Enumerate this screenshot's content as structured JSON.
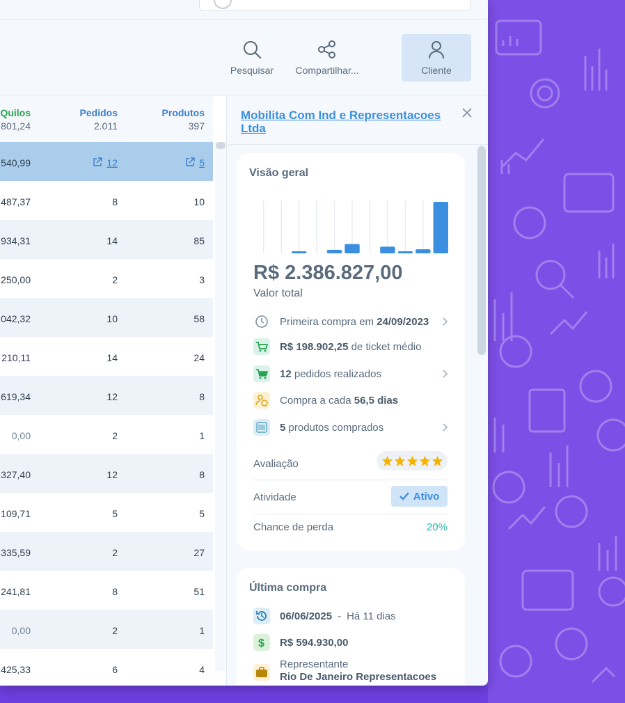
{
  "toolbar": {
    "search_label": "Pesquisar",
    "share_label": "Compartilhar...",
    "client_label": "Cliente"
  },
  "table": {
    "columns": [
      {
        "label": "Quilos",
        "total": "801,24"
      },
      {
        "label": "Pedidos",
        "total": "2.011"
      },
      {
        "label": "Produtos",
        "total": "397"
      }
    ],
    "rows": [
      {
        "quilos": "540,99",
        "pedidos": "12",
        "produtos": "5"
      },
      {
        "quilos": "487,37",
        "pedidos": "8",
        "produtos": "10"
      },
      {
        "quilos": "934,31",
        "pedidos": "14",
        "produtos": "85"
      },
      {
        "quilos": "250,00",
        "pedidos": "2",
        "produtos": "3"
      },
      {
        "quilos": "042,32",
        "pedidos": "10",
        "produtos": "58"
      },
      {
        "quilos": "210,11",
        "pedidos": "14",
        "produtos": "24"
      },
      {
        "quilos": "619,34",
        "pedidos": "12",
        "produtos": "8"
      },
      {
        "quilos": "0,00",
        "pedidos": "2",
        "produtos": "1"
      },
      {
        "quilos": "327,40",
        "pedidos": "12",
        "produtos": "8"
      },
      {
        "quilos": "109,71",
        "pedidos": "5",
        "produtos": "5"
      },
      {
        "quilos": "335,59",
        "pedidos": "2",
        "produtos": "27"
      },
      {
        "quilos": "241,81",
        "pedidos": "8",
        "produtos": "51"
      },
      {
        "quilos": "0,00",
        "pedidos": "2",
        "produtos": "1"
      },
      {
        "quilos": "425,33",
        "pedidos": "6",
        "produtos": "4"
      }
    ]
  },
  "panel": {
    "company": "Mobilita Com Ind e Representacoes Ltda",
    "overview": {
      "title": "Visão geral",
      "total_value": "R$ 2.386.827,00",
      "total_label": "Valor total",
      "first_purchase_prefix": "Primeira compra em ",
      "first_purchase_date": "24/09/2023",
      "avg_ticket_value": "R$ 198.902,25",
      "avg_ticket_suffix": " de ticket médio",
      "orders_count": "12",
      "orders_suffix": " pedidos realizados",
      "frequency_prefix": "Compra a cada ",
      "frequency_value": "56,5 dias",
      "products_count": "5",
      "products_suffix": " produtos comprados",
      "rating_label": "Avaliação",
      "rating_stars": 5,
      "activity_label": "Atividade",
      "activity_value": "Ativo",
      "loss_label": "Chance de perda",
      "loss_value": "20%"
    },
    "last_purchase": {
      "title": "Última compra",
      "date": "06/06/2025",
      "separator": "-",
      "ago": "Há 11 dias",
      "value": "R$ 594.930,00",
      "rep_label": "Representante",
      "rep_name": "Rio De Janeiro Representacoes"
    }
  },
  "chart_data": {
    "type": "bar",
    "values": [
      0,
      0,
      0.03,
      0,
      0.07,
      0.18,
      0,
      0.13,
      0.03,
      0.08,
      1.0
    ],
    "ylim": [
      0,
      1
    ]
  },
  "colors": {
    "accent": "#3b8fe0",
    "header_green": "#2aa24f",
    "header_blue": "#3b7fc9",
    "background_purple": "#7c4fe6",
    "loss_teal": "#2ab3a6",
    "star": "#f5b400"
  }
}
